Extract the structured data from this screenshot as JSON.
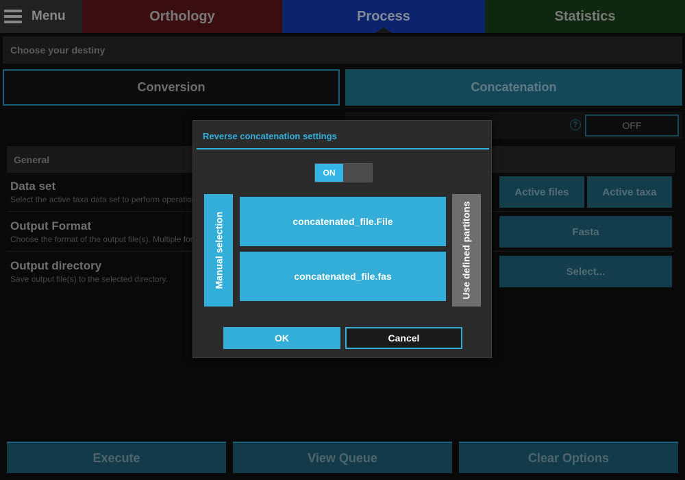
{
  "menu": {
    "label": "Menu",
    "icon": "hamburger-icon"
  },
  "tabs": [
    {
      "label": "Orthology",
      "color": "#5a1616"
    },
    {
      "label": "Process",
      "color": "#1238a6",
      "active": true
    },
    {
      "label": "Statistics",
      "color": "#173d17"
    }
  ],
  "destiny": {
    "title": "Choose your destiny",
    "conversion_label": "Conversion",
    "concatenation_label": "Concatenation"
  },
  "reverse_toggle": {
    "help_icon": "?",
    "state_label": "OFF"
  },
  "general": {
    "title": "General",
    "options": [
      {
        "title": "Data set",
        "description": "Select the active taxa data set to perform operations on"
      },
      {
        "title": "Output Format",
        "description": "Choose the format of the output file(s). Multiple formats may be selected"
      },
      {
        "title": "Output directory",
        "description": "Save output file(s) to the selected directory."
      }
    ],
    "data_set_buttons": [
      "Active files",
      "Active taxa"
    ],
    "output_format_value": "Fasta",
    "output_directory_button": "Select..."
  },
  "bottom": {
    "execute": "Execute",
    "view_queue": "View Queue",
    "clear_options": "Clear Options"
  },
  "modal": {
    "title": "Reverse concatenation settings",
    "switch_label": "ON",
    "switch_on": true,
    "manual_selection": "Manual selection",
    "use_defined_partitions": "Use defined partitons",
    "files": [
      "concatenated_file.File",
      "concatenated_file.fas"
    ],
    "ok": "OK",
    "cancel": "Cancel",
    "accent_color": "#33b5e5"
  }
}
